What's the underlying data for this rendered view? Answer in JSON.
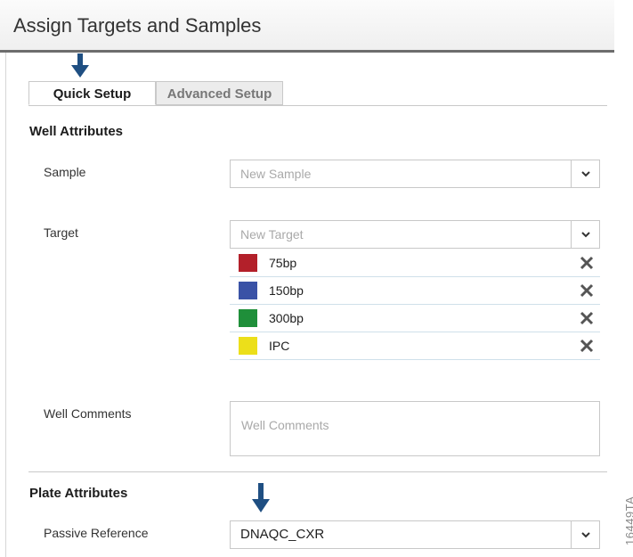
{
  "header": {
    "title": "Assign Targets and Samples"
  },
  "tabs": [
    {
      "label": "Quick Setup",
      "active": true
    },
    {
      "label": "Advanced Setup",
      "active": false
    }
  ],
  "well_attributes": {
    "title": "Well Attributes",
    "sample": {
      "label": "Sample",
      "placeholder": "New Sample"
    },
    "target": {
      "label": "Target",
      "placeholder": "New Target",
      "items": [
        {
          "name": "75bp",
          "color": "#b3202a"
        },
        {
          "name": "150bp",
          "color": "#3a52a6"
        },
        {
          "name": "300bp",
          "color": "#1f8f3a"
        },
        {
          "name": "IPC",
          "color": "#ecdf1a"
        }
      ]
    },
    "comments": {
      "label": "Well Comments",
      "placeholder": "Well Comments"
    }
  },
  "plate_attributes": {
    "title": "Plate Attributes",
    "passive_reference": {
      "label": "Passive Reference",
      "value": "DNAQC_CXR"
    }
  },
  "figure_id": "16449TA",
  "colors": {
    "arrow": "#1f4f82",
    "header_rule": "#6d6d6d"
  }
}
